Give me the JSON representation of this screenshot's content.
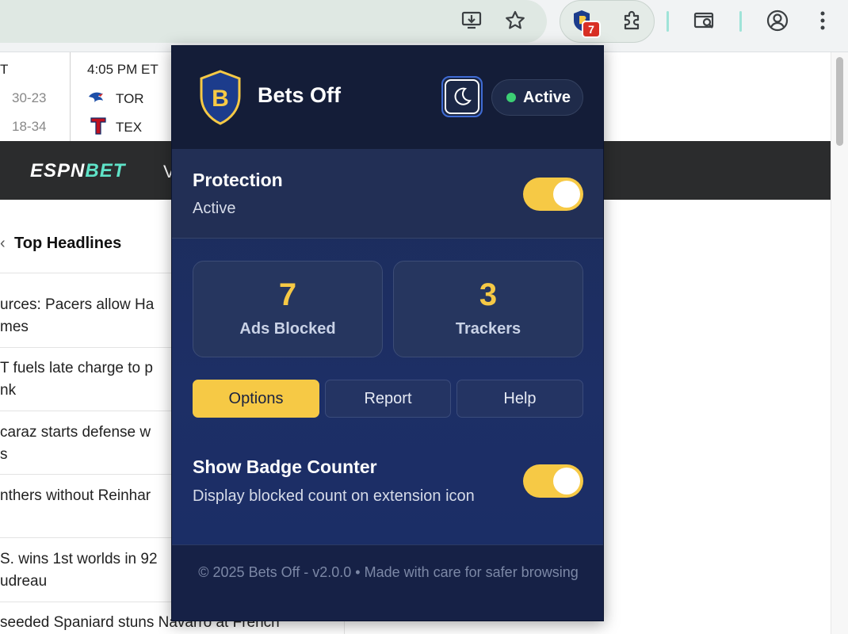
{
  "toolbar": {
    "icons": [
      "install-app-icon",
      "bookmark-star-icon",
      "extension-shield-icon",
      "extensions-puzzle-icon",
      "search-tab-icon",
      "profile-icon",
      "menu-icon"
    ],
    "extension_badge": "7"
  },
  "scoreboard": {
    "left_header": "T",
    "left_scores": [
      "30-23",
      "18-34"
    ],
    "game_time": "4:05 PM ET",
    "teams": [
      "TOR",
      "TEX"
    ]
  },
  "espn": {
    "logo_espn": "ESPN",
    "logo_bet": "BET",
    "nav_partial": "V"
  },
  "headlines": {
    "title": "Top Headlines",
    "items": [
      "urces: Pacers allow Ha\nmes",
      "T fuels late charge to p\nnk",
      "caraz starts defense w\ns",
      "nthers without Reinhar",
      "S. wins 1st worlds in 92\nudreau",
      "seeded Spaniard stuns Navarro at French"
    ]
  },
  "popup": {
    "title": "Bets Off",
    "logo_letter": "B",
    "status": "Active",
    "protection": {
      "title": "Protection",
      "subtitle": "Active",
      "enabled": true
    },
    "stats": [
      {
        "value": "7",
        "label": "Ads Blocked"
      },
      {
        "value": "3",
        "label": "Trackers"
      }
    ],
    "buttons": {
      "options": "Options",
      "report": "Report",
      "help": "Help"
    },
    "badge_counter": {
      "title": "Show Badge Counter",
      "subtitle": "Display blocked count on extension icon",
      "enabled": true
    },
    "footer": "© 2025 Bets Off - v2.0.0 • Made with care for safer browsing"
  },
  "colors": {
    "accent_yellow": "#f6c945",
    "popup_bg": "#1d2f66",
    "status_green": "#3ccf74",
    "badge_red": "#d93025"
  }
}
